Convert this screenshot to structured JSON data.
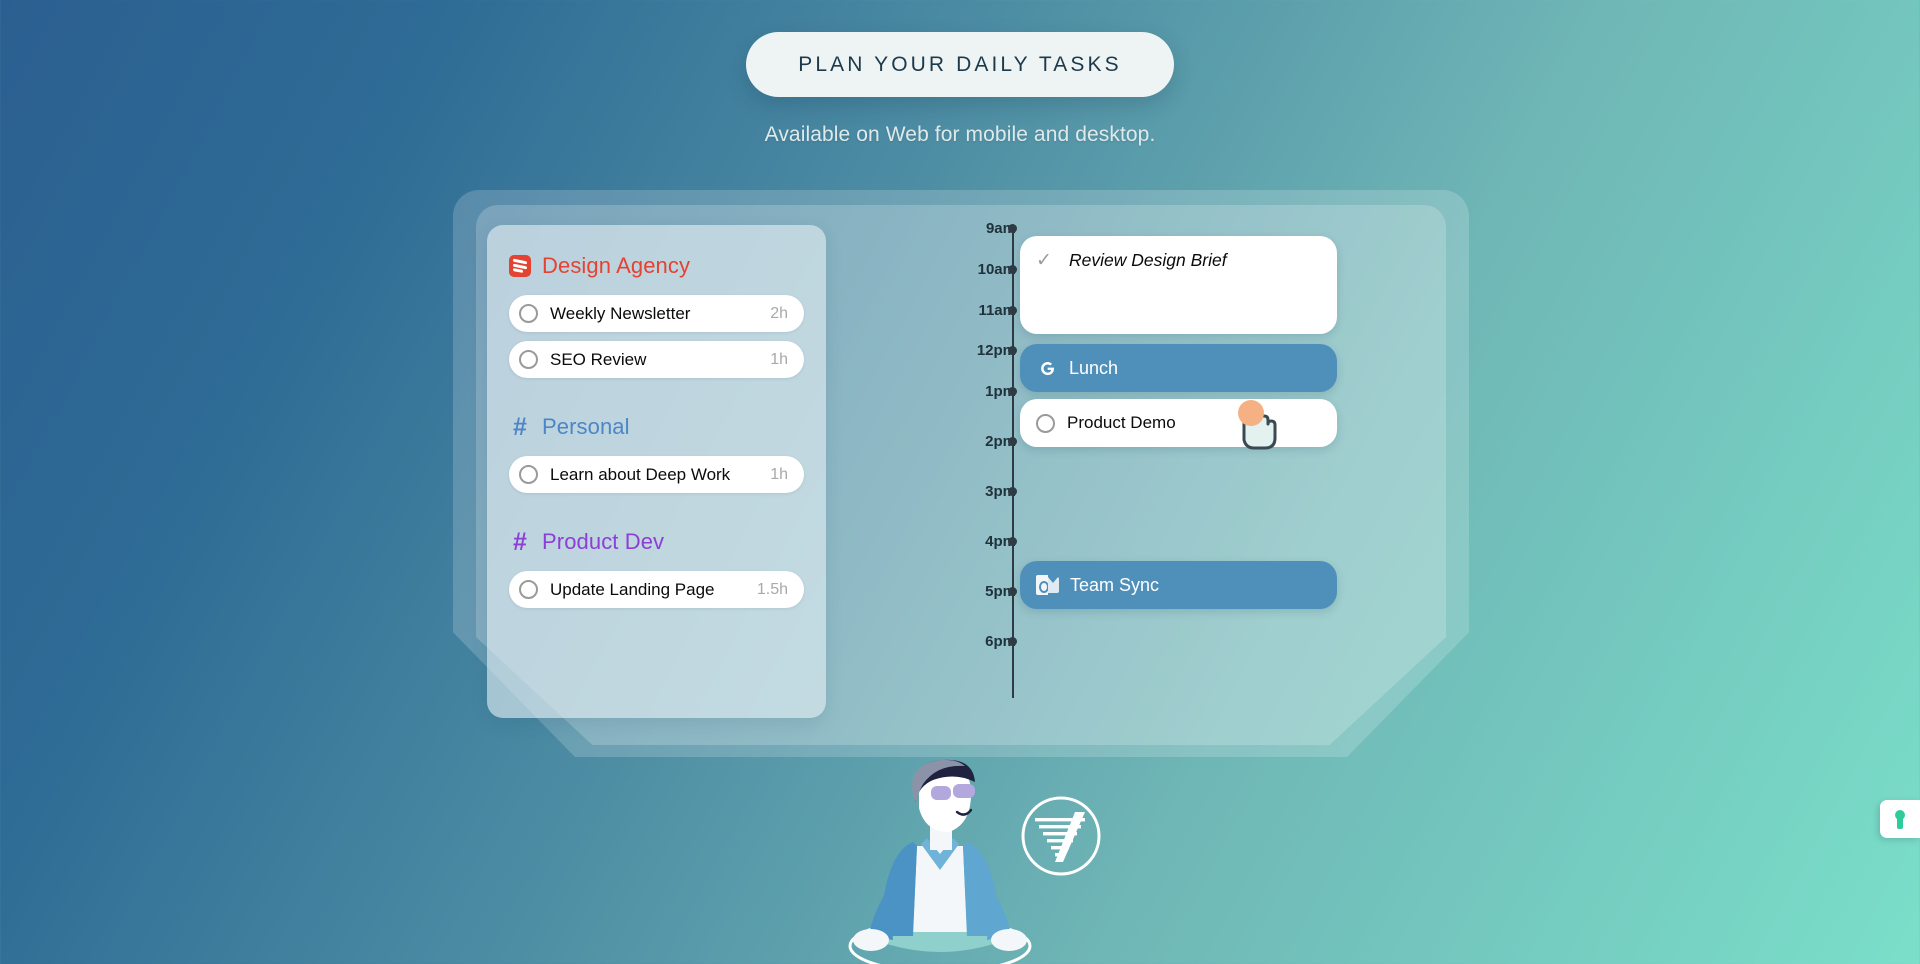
{
  "hero": {
    "pill_label": "PLAN YOUR DAILY TASKS",
    "subtitle": "Available on Web for mobile and desktop."
  },
  "colors": {
    "bg_start": "#2b5f91",
    "bg_end": "#7adfc9",
    "todoist_red": "#e44332",
    "personal_blue": "#4d86c6",
    "product_purple": "#8c3fd6",
    "event_blue": "#4f90bb",
    "click_orange": "#f5b183",
    "lock_green": "#2ecc9b"
  },
  "tasklist": {
    "groups": [
      {
        "name": "Design Agency",
        "icon": "todoist-icon",
        "color": "#e44332",
        "tasks": [
          {
            "title": "Weekly Newsletter",
            "duration": "2h",
            "checked": false
          },
          {
            "title": "SEO Review",
            "duration": "1h",
            "checked": false
          }
        ]
      },
      {
        "name": "Personal",
        "icon": "hash-icon",
        "color": "#4d86c6",
        "tasks": [
          {
            "title": "Learn about Deep Work",
            "duration": "1h",
            "checked": false
          }
        ]
      },
      {
        "name": "Product Dev",
        "icon": "hash-icon",
        "color": "#8c3fd6",
        "tasks": [
          {
            "title": "Update Landing Page",
            "duration": "1.5h",
            "checked": false
          }
        ]
      }
    ]
  },
  "timeline": {
    "hours": [
      "9am",
      "10am",
      "11am",
      "12pm",
      "1pm",
      "2pm",
      "3pm",
      "4pm",
      "5pm",
      "6pm"
    ]
  },
  "events": [
    {
      "title": "Review Design Brief",
      "style": "white",
      "icon": "check-icon",
      "state": "completed"
    },
    {
      "title": "Lunch",
      "style": "blue",
      "icon": "google-calendar-icon",
      "state": "scheduled"
    },
    {
      "title": "Product Demo",
      "style": "white",
      "icon": "checkbox-icon",
      "state": "scheduled"
    },
    {
      "title": "Team Sync",
      "style": "blue",
      "icon": "outlook-icon",
      "state": "scheduled"
    }
  ],
  "cursor": {
    "type": "pointer-hand-cursor",
    "state": "clicking"
  },
  "edge_tab": {
    "icon": "lock-keyhole-icon"
  },
  "illustration": {
    "name": "meditating-person-illustration",
    "badge": "v-logo-badge"
  }
}
